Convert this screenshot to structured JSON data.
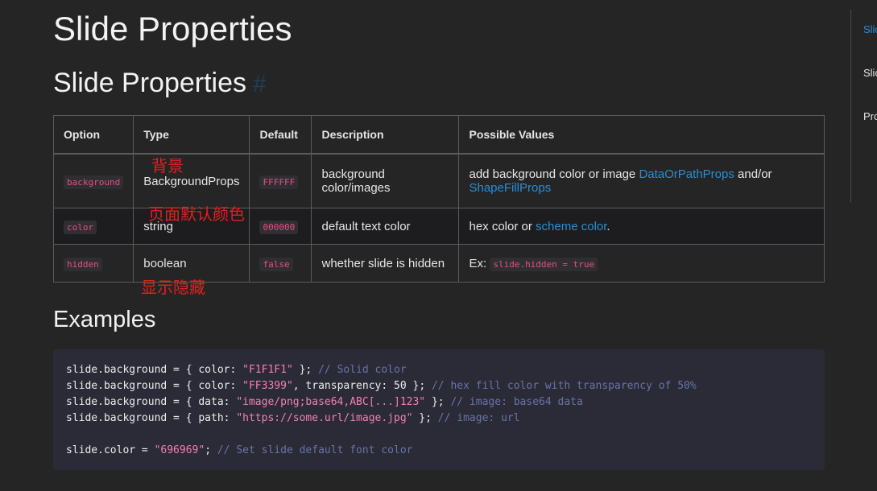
{
  "page": {
    "title": "Slide Properties",
    "section_title": "Slide Properties",
    "anchor_symbol": "#"
  },
  "table": {
    "headers": [
      "Option",
      "Type",
      "Default",
      "Description",
      "Possible Values"
    ],
    "rows": [
      {
        "option": "background",
        "type": "BackgroundProps",
        "default": "FFFFFF",
        "description": "background color/images",
        "values_prefix": "add background color or image ",
        "values_link1": "DataOrPathProps",
        "values_mid": " and/or ",
        "values_link2": "ShapeFillProps"
      },
      {
        "option": "color",
        "type": "string",
        "default": "000000",
        "description": "default text color",
        "values_prefix": "hex color or ",
        "values_link1": "scheme color",
        "values_suffix": "."
      },
      {
        "option": "hidden",
        "type": "boolean",
        "default": "false",
        "description": "whether slide is hidden",
        "values_prefix": "Ex: ",
        "values_code": "slide.hidden = true"
      }
    ]
  },
  "annotations": {
    "background": "背景",
    "color": "页面默认颜色",
    "hidden": "显示隐藏"
  },
  "examples": {
    "title": "Examples",
    "lines": [
      {
        "pre": "slide.background = { color: ",
        "str": "\"F1F1F1\"",
        "post": " }; ",
        "comment": "// Solid color"
      },
      {
        "pre": "slide.background = { color: ",
        "str": "\"FF3399\"",
        "post": ", transparency: 50 }; ",
        "comment": "// hex fill color with transparency of 50%"
      },
      {
        "pre": "slide.background = { data: ",
        "str": "\"image/png;base64,ABC[...]123\"",
        "post": " }; ",
        "comment": "// image: base64 data"
      },
      {
        "pre": "slide.background = { path: ",
        "str": "\"https://some.url/image.jpg\"",
        "post": " }; ",
        "comment": "// image: url"
      },
      {
        "pre": "slide.color = ",
        "str": "\"696969\"",
        "post": "; ",
        "comment": "// Set slide default font color"
      }
    ]
  },
  "toc": {
    "items": [
      "Slic",
      "Slic",
      "Pro"
    ]
  },
  "colors": {
    "background": "#252526",
    "link": "#2a8ed4",
    "code_string": "#f280b0",
    "code_comment": "#6a73a8",
    "annotation": "#e02020",
    "inline_code": "#ea4a86"
  }
}
